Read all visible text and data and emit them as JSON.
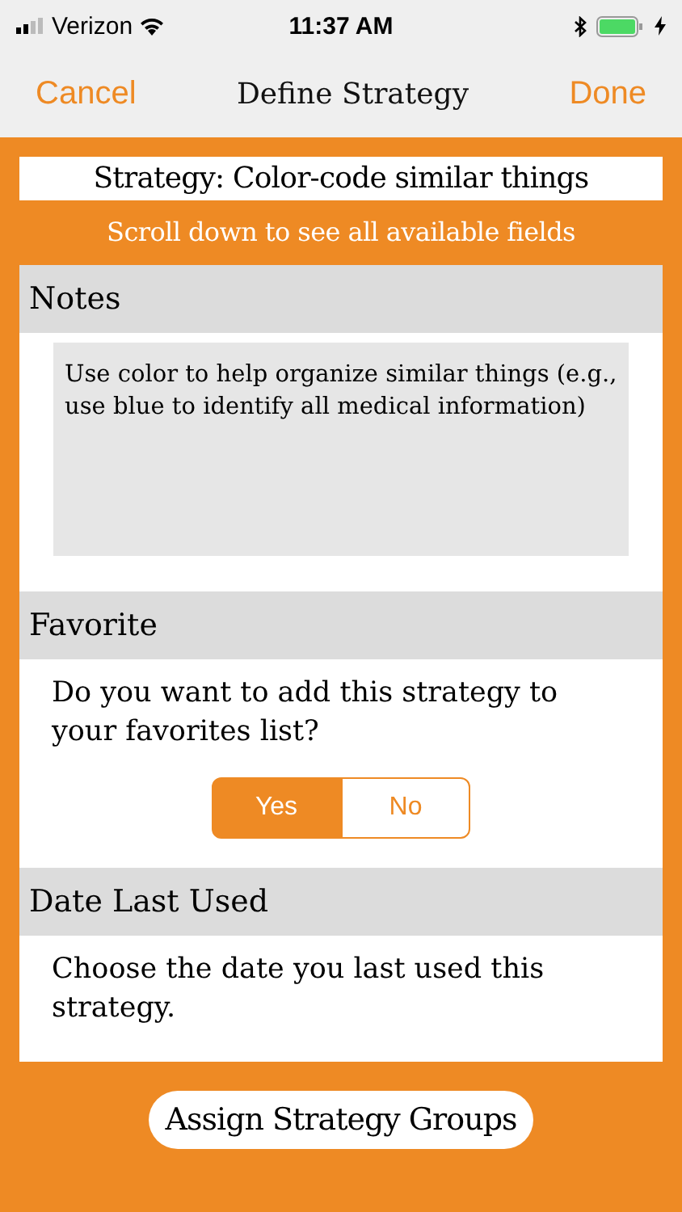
{
  "status_bar": {
    "carrier": "Verizon",
    "time": "11:37 AM"
  },
  "nav": {
    "cancel": "Cancel",
    "title": "Define Strategy",
    "done": "Done"
  },
  "strategy_title": "Strategy: Color-code similar things",
  "hint": "Scroll down to see all available fields",
  "sections": [
    {
      "kind": "notes",
      "header": "Notes",
      "value": "Use color to help organize similar things (e.g., use blue to identify all medical information)"
    },
    {
      "kind": "choice",
      "header": "Favorite",
      "prompt": "Do you want to add this strategy to your favorites list?",
      "options": [
        {
          "label": "Yes",
          "selected": true
        },
        {
          "label": "No",
          "selected": false
        }
      ]
    },
    {
      "kind": "text",
      "header": "Date Last Used",
      "prompt": "Choose the date you last used this strategy."
    }
  ],
  "assign_button": "Assign Strategy Groups"
}
